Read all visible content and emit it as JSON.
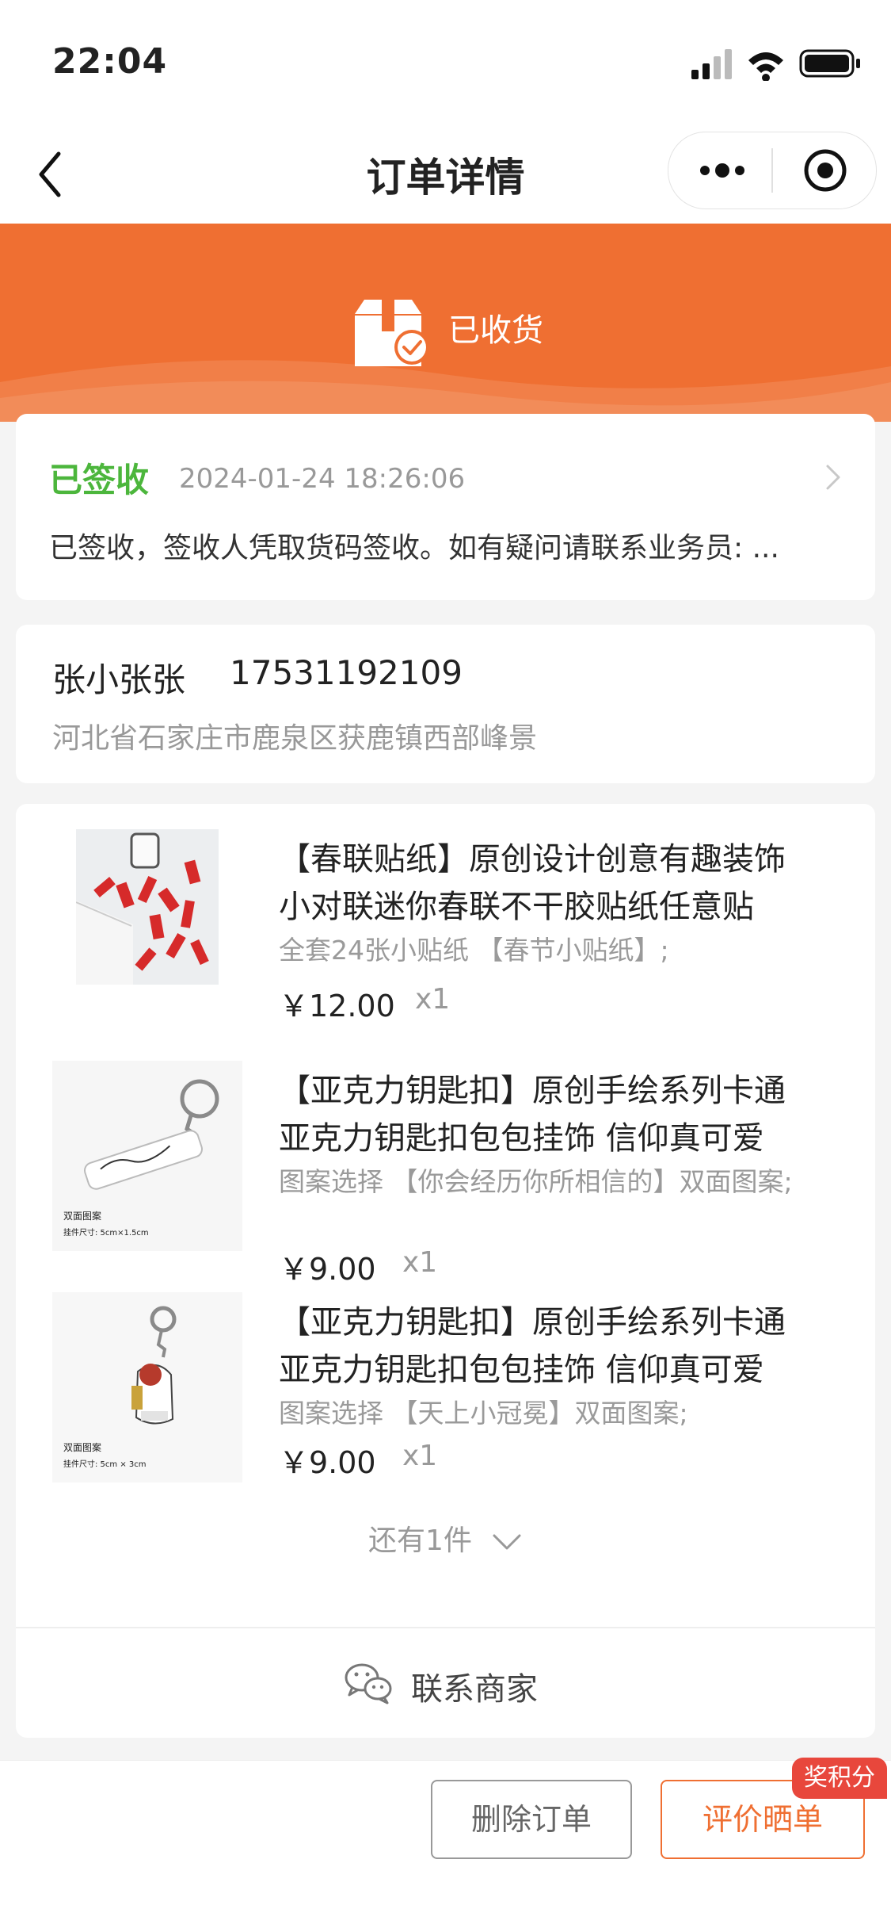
{
  "status_bar": {
    "time": "22:04"
  },
  "nav": {
    "title": "订单详情"
  },
  "hero": {
    "status_text": "已收货",
    "color": "#ef6f32"
  },
  "logistics": {
    "status": "已签收",
    "time": "2024-01-24 18:26:06",
    "description": "已签收，签收人凭取货码签收。如有疑问请联系业务员: ..."
  },
  "address": {
    "name": "张小张张",
    "phone": "17531192109",
    "detail": "河北省石家庄市鹿泉区获鹿镇西部峰景"
  },
  "items": [
    {
      "title_line1": "【春联贴纸】原创设计创意有趣装饰",
      "title_line2": "小对联迷你春联不干胶贴纸任意贴",
      "spec": "全套24张小贴纸 【春节小贴纸】;",
      "price": "￥12.00",
      "qty": "x1"
    },
    {
      "title_line1": "【亚克力钥匙扣】原创手绘系列卡通",
      "title_line2": "亚克力钥匙扣包包挂饰 信仰真可爱",
      "spec": "图案选择 【你会经历你所相信的】双面图案;",
      "price": "￥9.00",
      "qty": "x1",
      "thumb_caption1": "双面图案",
      "thumb_caption2": "挂件尺寸: 5cm×1.5cm"
    },
    {
      "title_line1": "【亚克力钥匙扣】原创手绘系列卡通",
      "title_line2": "亚克力钥匙扣包包挂饰 信仰真可爱",
      "spec": "图案选择 【天上小冠冕】双面图案;",
      "price": "￥9.00",
      "qty": "x1",
      "thumb_caption1": "双面图案",
      "thumb_caption2": "挂件尺寸: 5cm × 3cm"
    }
  ],
  "more": {
    "label": "还有1件"
  },
  "contact": {
    "label": "联系商家"
  },
  "actions": {
    "delete_label": "删除订单",
    "review_label": "评价晒单",
    "badge": "奖积分"
  },
  "colors": {
    "accent": "#ef6f32",
    "success": "#4cb63c",
    "badge": "#e8473c"
  }
}
